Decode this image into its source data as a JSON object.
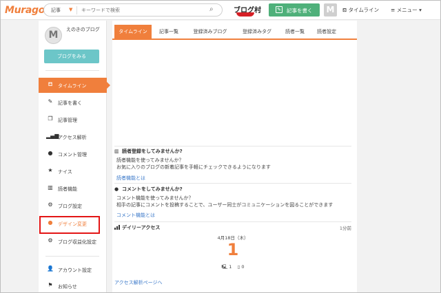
{
  "header": {
    "logo": "Muragon",
    "search_category": "記事",
    "search_placeholder": "キーワードで検索",
    "blogmura_label": "ブログ村",
    "write_button": "記事を書く",
    "avatar_letter": "M",
    "timeline_label": "タイムライン",
    "menu_label": "メニュー",
    "accent": "#f07f3c",
    "write_color": "#4fb07a"
  },
  "sidebar": {
    "profile_name": "えのきのブログ",
    "avatar_letter": "M",
    "view_blog_button": "ブログをみる",
    "items": [
      {
        "label": "タイムライン",
        "icon": "timeline-icon"
      },
      {
        "label": "記事を書く",
        "icon": "edit-icon"
      },
      {
        "label": "記事管理",
        "icon": "articles-icon"
      },
      {
        "label": "アクセス解析",
        "icon": "bar-chart-icon"
      },
      {
        "label": "コメント管理",
        "icon": "comment-icon"
      },
      {
        "label": "ナイス",
        "icon": "star-icon"
      },
      {
        "label": "読者機能",
        "icon": "book-icon"
      },
      {
        "label": "ブログ設定",
        "icon": "gear-icon"
      },
      {
        "label": "デザイン変更",
        "icon": "palette-icon"
      },
      {
        "label": "ブログ収益化設定",
        "icon": "gear-icon"
      },
      {
        "label": "アカウント設定",
        "icon": "user-icon"
      },
      {
        "label": "お知らせ",
        "icon": "flag-icon"
      }
    ]
  },
  "tabs": [
    "タイムライン",
    "記事一覧",
    "登録済みブログ",
    "登録済みタグ",
    "読者一覧",
    "読者設定"
  ],
  "reader_section": {
    "title": "読者登録をしてみませんか?",
    "line1": "読者機能を使ってみませんか？",
    "line2": "お気に入りのブログの新着記事を手軽にチェックできるようになります",
    "link": "読者機能とは"
  },
  "comment_section": {
    "title": "コメントをしてみませんか?",
    "line1": "コメント機能を使ってみませんか？",
    "line2": "相手の記事にコメントを投稿することで、ユーザー同士がコミュニケーションを図ることができます",
    "link": "コメント機能とは"
  },
  "daily_access": {
    "title": "デイリーアクセス",
    "time_ago": "1分前",
    "date": "4月18日（木）",
    "count": "1",
    "pc_count": "1",
    "mobile_count": "0",
    "link": "アクセス解析ページへ"
  }
}
